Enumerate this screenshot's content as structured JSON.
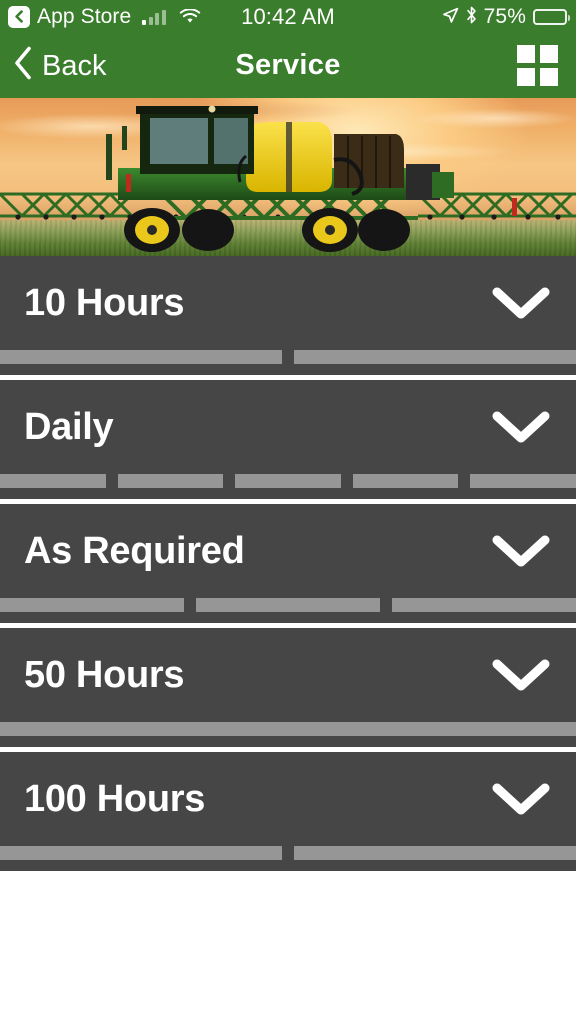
{
  "status_bar": {
    "back_app_label": "App Store",
    "back_badge_icon": "back-chevron-icon",
    "signal_icon": "cellular-signal-icon",
    "signal_bars_filled": 1,
    "signal_bars_total": 4,
    "wifi_icon": "wifi-icon",
    "time": "10:42 AM",
    "location_icon": "location-arrow-icon",
    "bluetooth_icon": "bluetooth-icon",
    "battery_percent": "75%",
    "battery_level": 75,
    "battery_icon": "battery-icon"
  },
  "nav_bar": {
    "back_icon": "chevron-left-icon",
    "back_label": "Back",
    "title": "Service",
    "grid_icon": "grid-menu-icon"
  },
  "hero": {
    "alt": "john-deere-sprayer-photo",
    "machine": "self-propelled-sprayer",
    "scene": "sunset-field"
  },
  "sections": [
    {
      "title": "10 Hours",
      "chevron_icon": "chevron-down-icon",
      "expanded": false,
      "row_chips": 2
    },
    {
      "title": "Daily",
      "chevron_icon": "chevron-down-icon",
      "expanded": false,
      "row_chips": 5
    },
    {
      "title": "As Required",
      "chevron_icon": "chevron-down-icon",
      "expanded": false,
      "row_chips": 3
    },
    {
      "title": "50 Hours",
      "chevron_icon": "chevron-down-icon",
      "expanded": false,
      "row_chips": 1
    },
    {
      "title": "100 Hours",
      "chevron_icon": "chevron-down-icon",
      "expanded": false,
      "row_chips": 2
    }
  ],
  "colors": {
    "brand_green": "#3A7D2C",
    "panel_dark": "#464646",
    "chip_gray": "#969696",
    "divider_white": "#FFFFFF",
    "text_white": "#FFFFFF"
  }
}
